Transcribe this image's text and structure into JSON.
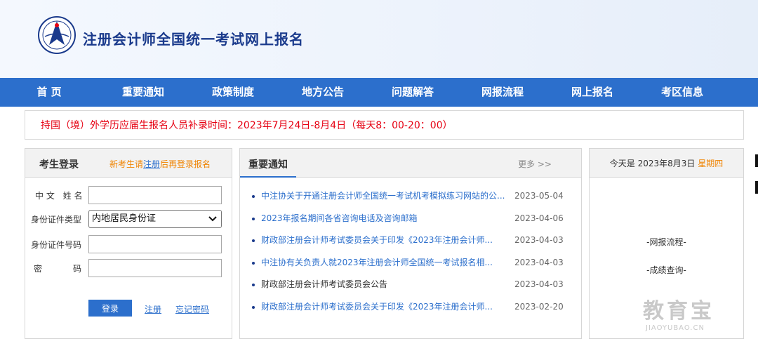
{
  "site": {
    "title": "注册会计师全国统一考试网上报名"
  },
  "nav": {
    "items": [
      "首 页",
      "重要通知",
      "政策制度",
      "地方公告",
      "问题解答",
      "网报流程",
      "网上报名",
      "考区信息"
    ]
  },
  "notice": {
    "text": "持国（境）外学历应届生报名人员补录时间：2023年7月24日-8月4日（每天8：00-20：00）"
  },
  "login": {
    "title": "考生登录",
    "hint_prefix": "新考生请",
    "hint_link": "注册",
    "hint_suffix": "后再登录报名",
    "name_label_a": "中 文",
    "name_label_b": "姓 名",
    "id_type_label": "身份证件类型",
    "id_type_value": "内地居民身份证",
    "id_no_label": "身份证件号码",
    "pwd_label_a": "密",
    "pwd_label_b": "码",
    "login_button": "登录",
    "register_link": "注册",
    "forgot_link": "忘记密码"
  },
  "news": {
    "title": "重要通知",
    "more": "更多 >>",
    "items": [
      {
        "title": "中注协关于开通注册会计师全国统一考试机考模拟练习网站的公...",
        "date": "2023-05-04"
      },
      {
        "title": "2023年报名期间各省咨询电话及咨询邮箱",
        "date": "2023-04-06"
      },
      {
        "title": "财政部注册会计师考试委员会关于印发《2023年注册会计师...",
        "date": "2023-04-03"
      },
      {
        "title": "中注协有关负责人就2023年注册会计师全国统一考试报名相...",
        "date": "2023-04-03"
      },
      {
        "title": "财政部注册会计师考试委员会公告",
        "date": "2023-04-03"
      },
      {
        "title": "财政部注册会计师考试委员会关于印发《2023年注册会计师...",
        "date": "2023-02-20"
      }
    ]
  },
  "side": {
    "date_prefix": "今天是 2023年8月3日 ",
    "weekday": "星期四",
    "link1": "-网报流程-",
    "link2": "-成绩查询-"
  },
  "watermark": {
    "big": "教育宝",
    "small": "JIAOYUBAO.CN"
  },
  "colors": {
    "nav": "#2c6fcc",
    "title": "#1a3a8c",
    "notice": "#e60012",
    "accent": "#f08300"
  }
}
